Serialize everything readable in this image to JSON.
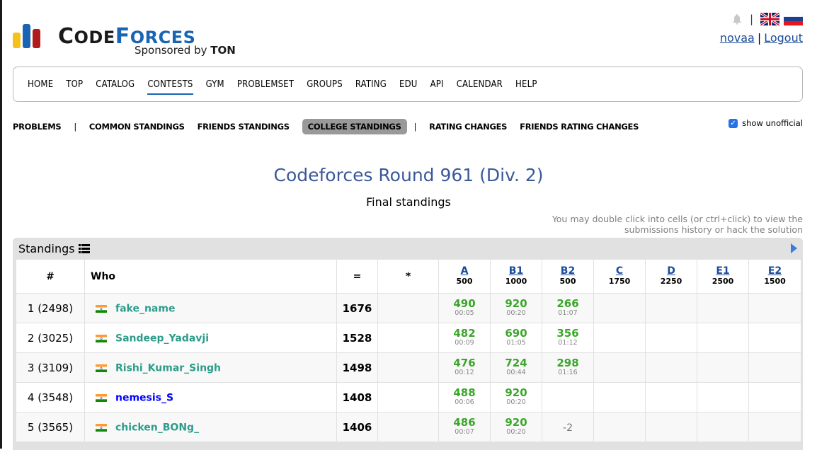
{
  "brand": {
    "logo_main_c": "C",
    "logo_main_ode": "ODE",
    "logo_main_f": "F",
    "logo_main_orces": "ORCES",
    "sponsor_text": "Sponsored by",
    "sponsor_brand": "TON",
    "colors": {
      "bar1": "#f4c21b",
      "bar2": "#1a65b3",
      "bar3": "#b21b1c"
    }
  },
  "header": {
    "separator": "|",
    "user": "novaa",
    "link_separator": "|",
    "logout": "Logout"
  },
  "menu": {
    "items": [
      "HOME",
      "TOP",
      "CATALOG",
      "CONTESTS",
      "GYM",
      "PROBLEMSET",
      "GROUPS",
      "RATING",
      "EDU",
      "API",
      "CALENDAR",
      "HELP"
    ],
    "active": "CONTESTS"
  },
  "second_menu": {
    "problems": "PROBLEMS",
    "divider": "|",
    "common": "COMMON STANDINGS",
    "friends": "FRIENDS STANDINGS",
    "college": "COLLEGE STANDINGS",
    "rating_changes": "RATING CHANGES",
    "friends_rating": "FRIENDS RATING CHANGES",
    "show_unofficial": "show unofficial"
  },
  "contest": {
    "title": "Codeforces Round 961 (Div. 2)",
    "subtitle": "Final standings",
    "hint_line1": "You may double click into cells (or ctrl+click) to view the",
    "hint_line2": "submissions history or hack the solution"
  },
  "standings": {
    "label": "Standings",
    "headers": {
      "rank": "#",
      "who": "Who",
      "score": "=",
      "penalty": "*"
    },
    "problems": [
      {
        "id": "A",
        "points": "500"
      },
      {
        "id": "B1",
        "points": "1000"
      },
      {
        "id": "B2",
        "points": "500"
      },
      {
        "id": "C",
        "points": "1750"
      },
      {
        "id": "D",
        "points": "2250"
      },
      {
        "id": "E1",
        "points": "2500"
      },
      {
        "id": "E2",
        "points": "1500"
      }
    ],
    "rows": [
      {
        "rank": "1 (2498)",
        "handle": "fake_name",
        "handle_color": "cyan",
        "score": "1676",
        "cells": [
          {
            "s": "490",
            "t": "00:05"
          },
          {
            "s": "920",
            "t": "00:20"
          },
          {
            "s": "266",
            "t": "01:07"
          }
        ]
      },
      {
        "rank": "2 (3025)",
        "handle": "Sandeep_Yadavji",
        "handle_color": "cyan",
        "score": "1528",
        "cells": [
          {
            "s": "482",
            "t": "00:09"
          },
          {
            "s": "690",
            "t": "01:05"
          },
          {
            "s": "356",
            "t": "01:12"
          }
        ]
      },
      {
        "rank": "3 (3109)",
        "handle": "Rishi_Kumar_Singh",
        "handle_color": "cyan",
        "score": "1498",
        "cells": [
          {
            "s": "476",
            "t": "00:12"
          },
          {
            "s": "724",
            "t": "00:44"
          },
          {
            "s": "298",
            "t": "01:16"
          }
        ]
      },
      {
        "rank": "4 (3548)",
        "handle": "nemesis_S",
        "handle_color": "blue",
        "score": "1408",
        "cells": [
          {
            "s": "488",
            "t": "00:06"
          },
          {
            "s": "920",
            "t": "00:20"
          }
        ]
      },
      {
        "rank": "5 (3565)",
        "handle": "chicken_BONg_",
        "handle_color": "cyan",
        "score": "1406",
        "cells": [
          {
            "s": "486",
            "t": "00:07"
          },
          {
            "s": "920",
            "t": "00:20"
          },
          {
            "neg": "-2"
          }
        ]
      }
    ]
  }
}
